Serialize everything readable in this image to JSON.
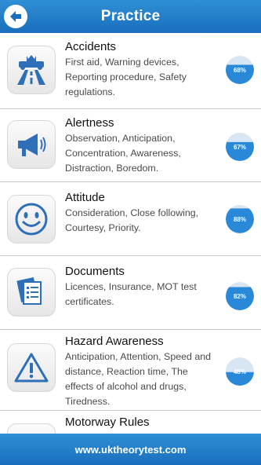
{
  "header": {
    "title": "Practice"
  },
  "topics": [
    {
      "name": "Accidents",
      "description": "First aid, Warning devices, Reporting procedure, Safety regulations.",
      "icon": "road-accident-icon",
      "percent_label": "68%",
      "percent": 68
    },
    {
      "name": "Alertness",
      "description": "Observation, Anticipation, Concentration, Awareness, Distraction, Boredom.",
      "icon": "megaphone-icon",
      "percent_label": "67%",
      "percent": 67
    },
    {
      "name": "Attitude",
      "description": "Consideration, Close following, Courtesy, Priority.",
      "icon": "smiley-icon",
      "percent_label": "88%",
      "percent": 88
    },
    {
      "name": "Documents",
      "description": "Licences, Insurance, MOT test certificates.",
      "icon": "documents-icon",
      "percent_label": "82%",
      "percent": 82
    },
    {
      "name": "Hazard Awareness",
      "description": "Anticipation, Attention, Speed and distance, Reaction time, The effects of alcohol and drugs, Tiredness.",
      "icon": "warning-triangle-icon",
      "percent_label": "48%",
      "percent": 48
    },
    {
      "name": "Motorway Rules",
      "description": "",
      "icon": "motorway-sign-icon",
      "percent_label": "",
      "percent": null
    }
  ],
  "footer": {
    "url": "www.uktheorytest.com"
  },
  "colors": {
    "accent": "#1f7ac6",
    "pct_fill": "#2a88d8",
    "pct_track": "#d8e6f3"
  }
}
